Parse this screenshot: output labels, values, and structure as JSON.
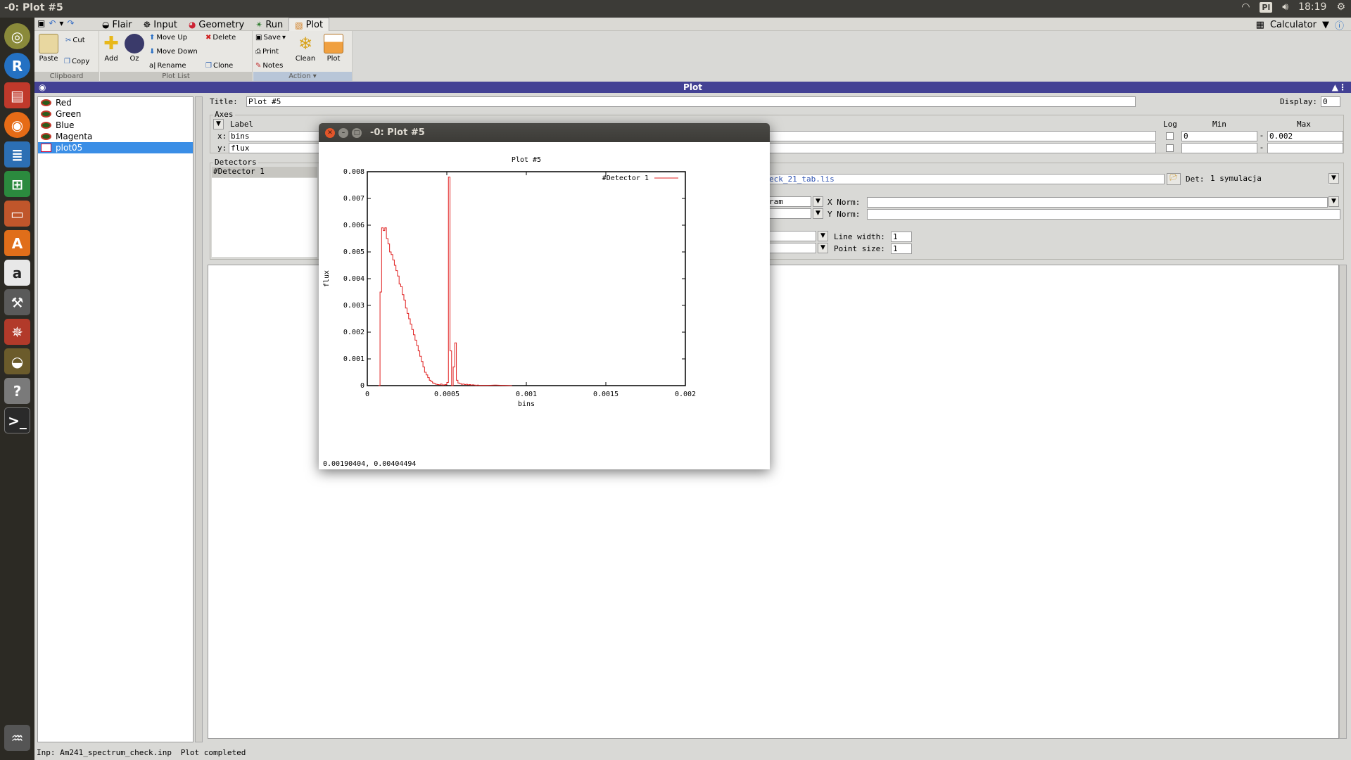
{
  "window": {
    "title": "-0: Plot #5"
  },
  "system_tray": {
    "keyboard": "Pl",
    "time": "18:19"
  },
  "launcher": {
    "items": [
      "ubuntu",
      "R",
      "files",
      "firefox",
      "writer",
      "calc",
      "impress",
      "software",
      "amazon",
      "settings",
      "network",
      "flair",
      "help",
      "terminal",
      "trash"
    ]
  },
  "quick_access": {
    "save": "save",
    "undo": "undo",
    "redo": "redo"
  },
  "menu": {
    "tabs": [
      {
        "label": "Flair",
        "active": false
      },
      {
        "label": "Input",
        "active": false
      },
      {
        "label": "Geometry",
        "active": false
      },
      {
        "label": "Run",
        "active": false
      },
      {
        "label": "Plot",
        "active": true
      }
    ],
    "calculator": "Calculator"
  },
  "ribbon": {
    "clipboard": {
      "label": "Clipboard",
      "paste": "Paste",
      "cut": "Cut",
      "copy": "Copy"
    },
    "plotlist": {
      "label": "Plot List",
      "add": "Add",
      "oz": "Oz",
      "move_up": "Move Up",
      "move_down": "Move Down",
      "rename": "Rename",
      "delete": "Delete",
      "clone": "Clone"
    },
    "action": {
      "label": "Action",
      "save": "Save",
      "print": "Print",
      "notes": "Notes",
      "clean": "Clean",
      "plot": "Plot"
    }
  },
  "panel_title": "Plot",
  "plot_list": {
    "items": [
      {
        "label": "Red",
        "selected": false
      },
      {
        "label": "Green",
        "selected": false
      },
      {
        "label": "Blue",
        "selected": false
      },
      {
        "label": "Magenta",
        "selected": false
      },
      {
        "label": "plot05",
        "selected": true
      }
    ]
  },
  "form": {
    "title_label": "Title:",
    "title_value": "Plot #5",
    "display_label": "Display:",
    "display_value": "0",
    "axes": {
      "frame_label": "Axes",
      "label_header": "Label",
      "log_header": "Log",
      "min_header": "Min",
      "max_header": "Max",
      "x_label": "x:",
      "x_value": "bins",
      "x_min": "0",
      "x_max": "0.002",
      "y_label": "y:",
      "y_value": "flux",
      "y_min": "",
      "y_max": ""
    },
    "detectors": {
      "frame_label": "Detectors",
      "item": "#Detector 1",
      "file_value": "eck_21_tab.lis",
      "det_label": "Det:",
      "det_value": "1 symulacja",
      "type_value": "ram",
      "x_norm_label": "X Norm:",
      "y_norm_label": "Y Norm:",
      "line_width_label": "Line width:",
      "line_width_value": "1",
      "point_size_label": "Point size:",
      "point_size_value": "1"
    }
  },
  "status_bar": {
    "input_file": "Inp: Am241_spectrum_check.inp",
    "message": "Plot completed"
  },
  "plot_window": {
    "title": "-0: Plot #5",
    "coord_readout": "0.00190404,  0.00404494"
  },
  "chart_data": {
    "type": "line",
    "title": "Plot #5",
    "xlabel": "bins",
    "ylabel": "flux",
    "xlim": [
      0,
      0.002
    ],
    "ylim": [
      0,
      0.008
    ],
    "x_ticks": [
      "0",
      "0.0005",
      "0.001",
      "0.0015",
      "0.002"
    ],
    "y_ticks": [
      "0",
      "0.001",
      "0.002",
      "0.003",
      "0.004",
      "0.005",
      "0.006",
      "0.007",
      "0.008"
    ],
    "legend_position": "top-right",
    "series": [
      {
        "name": "#Detector 1",
        "color": "#e02020",
        "step": true,
        "x": [
          7e-05,
          8e-05,
          9e-05,
          0.0001,
          0.00011,
          0.00012,
          0.00013,
          0.00014,
          0.00015,
          0.00016,
          0.00017,
          0.00018,
          0.00019,
          0.0002,
          0.00021,
          0.00022,
          0.00023,
          0.00024,
          0.00025,
          0.00026,
          0.00027,
          0.00028,
          0.00029,
          0.0003,
          0.00031,
          0.00032,
          0.00033,
          0.00034,
          0.00035,
          0.00036,
          0.00037,
          0.00038,
          0.00039,
          0.0004,
          0.00041,
          0.00042,
          0.00043,
          0.00044,
          0.00045,
          0.00046,
          0.00047,
          0.00048,
          0.00049,
          0.0005,
          0.00051,
          0.00052,
          0.00053,
          0.00054,
          0.00055,
          0.00056,
          0.00057,
          0.00058,
          0.00059,
          0.0006,
          0.00061,
          0.00062,
          0.00063,
          0.00064,
          0.00065,
          0.00066,
          0.00067,
          0.00068,
          0.00069,
          0.0007,
          0.00075,
          0.0008,
          0.00085,
          0.0009
        ],
        "values": [
          0.0,
          0.0035,
          0.0059,
          0.0058,
          0.0059,
          0.0055,
          0.0053,
          0.005,
          0.0049,
          0.0047,
          0.0045,
          0.0043,
          0.0041,
          0.0038,
          0.0037,
          0.0034,
          0.0032,
          0.0029,
          0.0027,
          0.0025,
          0.0023,
          0.0021,
          0.0019,
          0.0017,
          0.0015,
          0.0013,
          0.0011,
          0.0009,
          0.0007,
          0.0005,
          0.0004,
          0.0003,
          0.0002,
          0.00015,
          0.0001,
          8e-05,
          5e-05,
          4e-05,
          3e-05,
          6e-05,
          2e-05,
          3e-05,
          4e-05,
          0.00012,
          0.0078,
          0.0013,
          0.0,
          0.0007,
          0.0016,
          0.0002,
          0.0001,
          8e-05,
          5e-05,
          6e-05,
          4e-05,
          5e-05,
          3e-05,
          4e-05,
          2e-05,
          3e-05,
          2e-05,
          1e-05,
          2e-05,
          1e-05,
          1e-05,
          2e-05,
          1e-05,
          0.0
        ]
      }
    ]
  }
}
